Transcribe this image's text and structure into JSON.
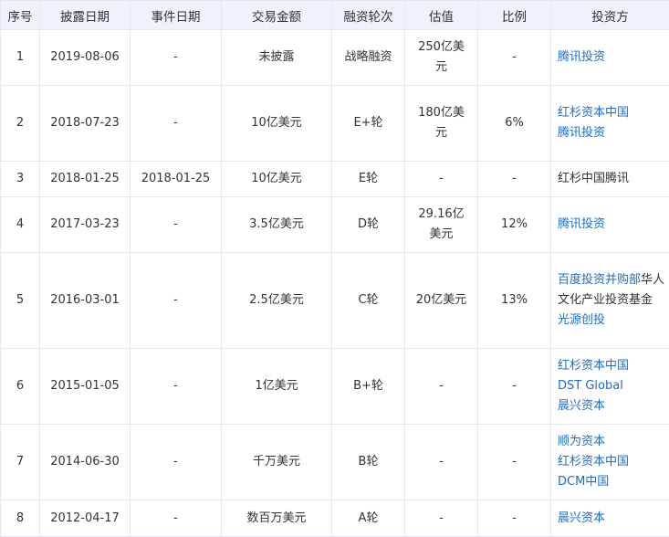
{
  "headers": [
    "序号",
    "披露日期",
    "事件日期",
    "交易金额",
    "融资轮次",
    "估值",
    "比例",
    "投资方"
  ],
  "rows": [
    {
      "no": "1",
      "disclosure_date": "2019-08-06",
      "event_date": "-",
      "amount": "未披露",
      "round": "战略融资",
      "valuation": "250亿美元",
      "ratio": "-",
      "investors": [
        {
          "text": "腾讯投资",
          "link": true
        }
      ]
    },
    {
      "no": "2",
      "disclosure_date": "2018-07-23",
      "event_date": "-",
      "amount": "10亿美元",
      "round": "E+轮",
      "valuation": "180亿美元",
      "ratio": "6%",
      "investors": [
        {
          "text": "红杉资本中国",
          "link": true
        },
        {
          "text": "腾讯投资",
          "link": true
        }
      ]
    },
    {
      "no": "3",
      "disclosure_date": "2018-01-25",
      "event_date": "2018-01-25",
      "amount": "10亿美元",
      "round": "E轮",
      "valuation": "-",
      "ratio": "-",
      "investors": [
        {
          "text": "红杉中国腾讯",
          "link": false
        }
      ]
    },
    {
      "no": "4",
      "disclosure_date": "2017-03-23",
      "event_date": "-",
      "amount": "3.5亿美元",
      "round": "D轮",
      "valuation": "29.16亿美元",
      "ratio": "12%",
      "investors": [
        {
          "text": "腾讯投资",
          "link": true
        }
      ]
    },
    {
      "no": "5",
      "disclosure_date": "2016-03-01",
      "event_date": "-",
      "amount": "2.5亿美元",
      "round": "C轮",
      "valuation": "20亿美元",
      "ratio": "13%",
      "investors": [
        {
          "text": "百度投资并购部",
          "link": true,
          "suffix": "华人文化产业投资基金"
        },
        {
          "text": "光源创投",
          "link": true
        }
      ]
    },
    {
      "no": "6",
      "disclosure_date": "2015-01-05",
      "event_date": "-",
      "amount": "1亿美元",
      "round": "B+轮",
      "valuation": "-",
      "ratio": "-",
      "investors": [
        {
          "text": "红杉资本中国",
          "link": true
        },
        {
          "text": "DST Global",
          "link": true
        },
        {
          "text": "晨兴资本",
          "link": true
        }
      ]
    },
    {
      "no": "7",
      "disclosure_date": "2014-06-30",
      "event_date": "-",
      "amount": "千万美元",
      "round": "B轮",
      "valuation": "-",
      "ratio": "-",
      "investors": [
        {
          "text": "顺为资本",
          "link": true
        },
        {
          "text": "红杉资本中国",
          "link": true
        },
        {
          "text": "DCM中国",
          "link": true
        }
      ]
    },
    {
      "no": "8",
      "disclosure_date": "2012-04-17",
      "event_date": "-",
      "amount": "数百万美元",
      "round": "A轮",
      "valuation": "-",
      "ratio": "-",
      "investors": [
        {
          "text": "晨兴资本",
          "link": true
        }
      ]
    }
  ],
  "colors": {
    "header_bg": "#eef3fb",
    "border": "#e3e8f0",
    "link": "#1a6dcc",
    "text": "#333333"
  }
}
